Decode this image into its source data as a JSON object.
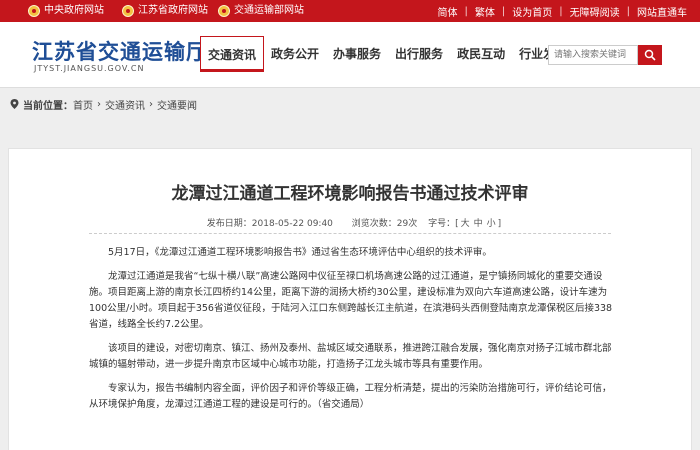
{
  "topbar": {
    "sites": [
      {
        "label": "中央政府网站"
      },
      {
        "label": "江苏省政府网站"
      },
      {
        "label": "交通运输部网站"
      }
    ],
    "links": [
      "简体",
      "繁体",
      "设为首页",
      "无障碍阅读",
      "网站直通车"
    ]
  },
  "header": {
    "title": "江苏省交通运输厅",
    "subtitle": "JTYST.JIANGSU.GOV.CN",
    "nav": [
      "交通资讯",
      "政务公开",
      "办事服务",
      "出行服务",
      "政民互动",
      "行业发展"
    ],
    "active_nav": "交通资讯",
    "search_placeholder": "请输入搜索关键词",
    "accent_color": "#c4161c",
    "title_color": "#1f4e96"
  },
  "breadcrumb": {
    "label": "当前位置：",
    "items": [
      "首页",
      "交通资讯",
      "交通要闻"
    ]
  },
  "article": {
    "title": "龙潭过江通道工程环境影响报告书通过技术评审",
    "publish_time": "发布日期：2018-05-22 09:40",
    "views": "浏览次数：29次",
    "font_size_label": "字号：[",
    "font_sizes": [
      "大",
      "中",
      "小"
    ],
    "font_size_end": "]",
    "paragraphs": [
      "5月17日，《龙潭过江通道工程环境影响报告书》通过省生态环境评估中心组织的技术评审。",
      "龙潭过江通道是我省“七纵十横八联”高速公路网中仪征至禄口机场高速公路的过江通道，是宁镇扬同城化的重要交通设施。项目距离上游的南京长江四桥约14公里，距离下游的润扬大桥约30公里，建设标准为双向六车道高速公路，设计车速为100公里/小时。项目起于356省道仪征段，于陆河入江口东侧跨越长江主航道，在滨港码头西侧登陆南京龙潭保税区后接338省道，线路全长约7.2公里。",
      "该项目的建设，对密切南京、镇江、扬州及泰州、盐城区域交通联系，推进跨江融合发展，强化南京对扬子江城市群北部城镇的辐射带动，进一步提升南京市区域中心城市功能，打造扬子江龙头城市等具有重要作用。",
      "专家认为，报告书编制内容全面，评价因子和评价等级正确，工程分析清楚，提出的污染防治措施可行，评价结论可信，从环境保护角度，龙潭过江通道工程的建设是可行的。（省交通局）"
    ]
  }
}
